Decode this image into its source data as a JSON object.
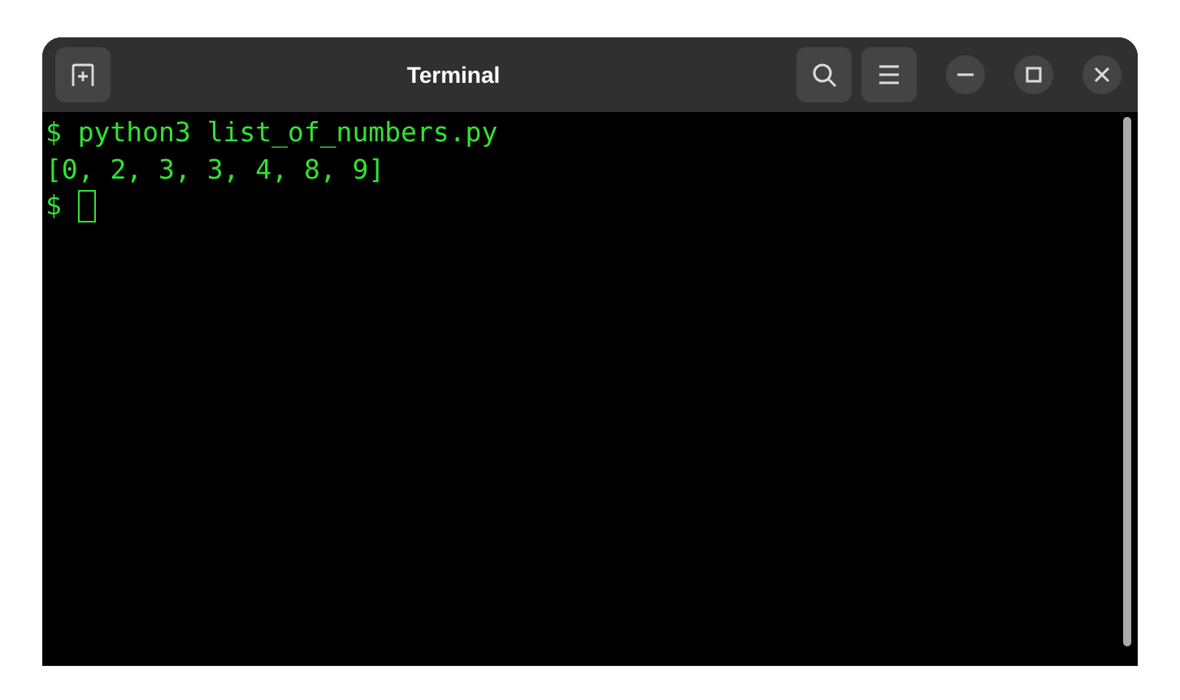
{
  "window": {
    "title": "Terminal"
  },
  "terminal": {
    "lines": [
      "$ python3 list_of_numbers.py",
      "[0, 2, 3, 3, 4, 8, 9]"
    ],
    "prompt": "$"
  }
}
